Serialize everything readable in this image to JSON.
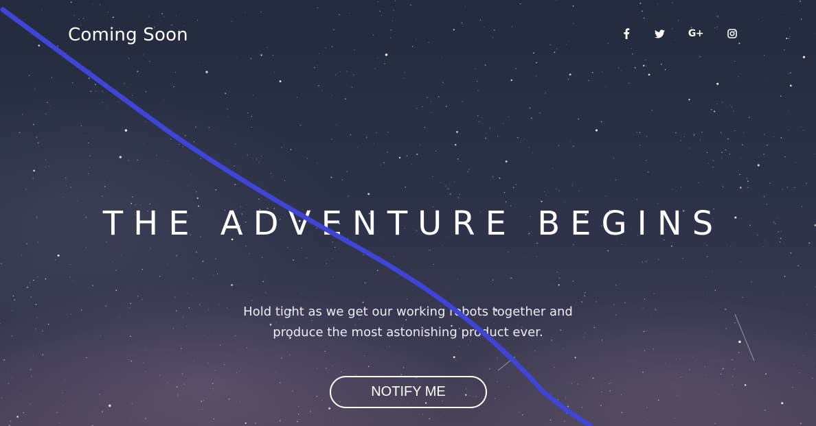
{
  "brand": {
    "title": "Coming Soon"
  },
  "social": [
    {
      "name": "facebook",
      "icon": "facebook-icon"
    },
    {
      "name": "twitter",
      "icon": "twitter-icon"
    },
    {
      "name": "google-plus",
      "icon": "google-plus-icon",
      "label": "G+"
    },
    {
      "name": "instagram",
      "icon": "instagram-icon"
    }
  ],
  "hero": {
    "title": "THE ADVENTURE BEGINS",
    "description_line1": "Hold tight as we get our working robots together and",
    "description_line2": "produce the most astonishing product ever."
  },
  "cta": {
    "label": "NOTIFY ME"
  },
  "colors": {
    "background_top": "#252b3e",
    "background_bottom": "#4a4358",
    "text": "#ffffff",
    "annotation_line": "#3f45d6"
  }
}
